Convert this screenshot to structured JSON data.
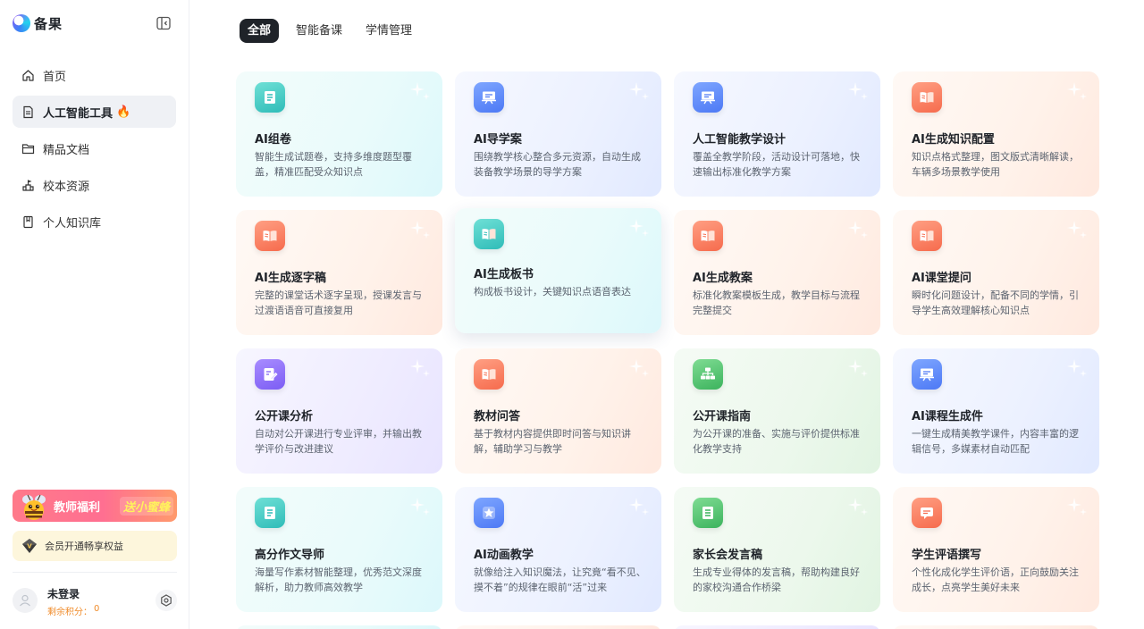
{
  "brand": {
    "name": "备果"
  },
  "nav": [
    {
      "label": "首页",
      "icon": "home-icon"
    },
    {
      "label": "人工智能工具",
      "icon": "document-icon",
      "badge": "🔥"
    },
    {
      "label": "精品文档",
      "icon": "folder-icon"
    },
    {
      "label": "校本资源",
      "icon": "school-icon"
    },
    {
      "label": "个人知识库",
      "icon": "book-icon"
    }
  ],
  "promo": {
    "line1": "教师福利",
    "line2": "送小蜜蜂"
  },
  "vip": {
    "label": "会员开通畅享权益"
  },
  "user": {
    "name": "未登录",
    "points_label": "剩余积分：",
    "points": "0"
  },
  "tabs": [
    "全部",
    "智能备课",
    "学情管理"
  ],
  "cards": [
    {
      "title": "AI组卷",
      "desc": "智能生成试题卷，支持多维度题型覆盖，精准匹配受众知识点",
      "theme": "cyan",
      "icon": "exam-paper-icon"
    },
    {
      "title": "AI导学案",
      "desc": "围绕教学核心整合多元资源，自动生成装备教学场景的导学方案",
      "theme": "blue",
      "icon": "presentation-icon"
    },
    {
      "title": "人工智能教学设计",
      "desc": "覆盖全教学阶段，活动设计可落地，快速输出标准化教学方案",
      "theme": "blue",
      "icon": "presentation-icon"
    },
    {
      "title": "AI生成知识配置",
      "desc": "知识点格式整理，图文版式清晰解读，车辆多场景教学使用",
      "theme": "orange",
      "icon": "open-book-icon"
    },
    {
      "title": "AI生成逐字稿",
      "desc": "完整的课堂话术逐字呈现，授课发言与过渡语语音可直接复用",
      "theme": "orange",
      "icon": "open-book-icon"
    },
    {
      "title": "AI生成板书",
      "desc": "构成板书设计，关键知识点语音表达",
      "theme": "cyan",
      "icon": "open-book-icon",
      "hover": true
    },
    {
      "title": "AI生成教案",
      "desc": "标准化教案模板生成，教学目标与流程完整提交",
      "theme": "orange",
      "icon": "open-book-icon"
    },
    {
      "title": "AI课堂提问",
      "desc": "瞬时化问题设计，配备不同的学情，引导学生高效理解核心知识点",
      "theme": "orange",
      "icon": "open-book-icon"
    },
    {
      "title": "公开课分析",
      "desc": "自动对公开课进行专业评审，并输出教学评价与改进建议",
      "theme": "purple",
      "icon": "edit-document-icon"
    },
    {
      "title": "教材问答",
      "desc": "基于教材内容提供即时问答与知识讲解，辅助学习与教学",
      "theme": "orange",
      "icon": "open-book-icon"
    },
    {
      "title": "公开课指南",
      "desc": "为公开课的准备、实施与评价提供标准化教学支持",
      "theme": "green",
      "icon": "org-chart-icon"
    },
    {
      "title": "AI课程生成件",
      "desc": "一键生成精美教学课件，内容丰富的逻辑信号，多媒素材自动匹配",
      "theme": "blue",
      "icon": "presentation-icon"
    },
    {
      "title": "高分作文导师",
      "desc": "海量写作素材智能整理，优秀范文深度解析，助力教师高效教学",
      "theme": "cyan",
      "icon": "exam-paper-icon"
    },
    {
      "title": "AI动画教学",
      "desc": "就像给注入知识魔法，让究竟“看不见、摸不着”的规律在眼前“活”过来",
      "theme": "blue",
      "icon": "star-badge-icon"
    },
    {
      "title": "家长会发言稿",
      "desc": "生成专业得体的发言稿，帮助构建良好的家校沟通合作桥梁",
      "theme": "green",
      "icon": "document-lines-icon"
    },
    {
      "title": "学生评语撰写",
      "desc": "个性化成化学生评价语，正向鼓励关注成长，点亮学生美好未来",
      "theme": "orange",
      "icon": "comment-card-icon"
    }
  ],
  "peek_themes": [
    "cyan",
    "orange",
    "purple",
    "orange"
  ]
}
